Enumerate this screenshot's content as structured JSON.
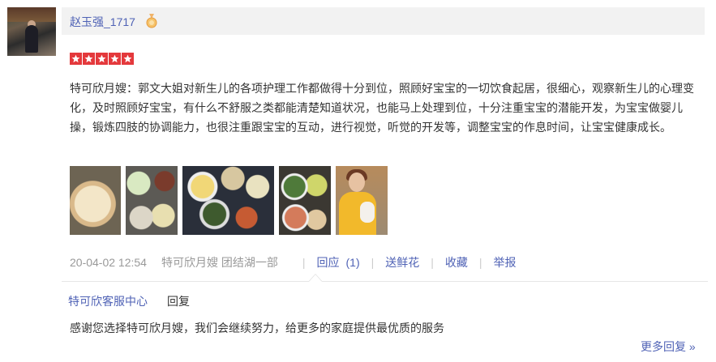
{
  "review": {
    "username": "赵玉强_1717",
    "badge_icon": "medal-icon",
    "rating": 5,
    "rating_color": "#e4393c",
    "text": "特可欣月嫂：郭文大姐对新生儿的各项护理工作都做得十分到位，照顾好宝宝的一切饮食起居，很细心，观察新生儿的心理变化，及时照顾好宝宝，有什么不舒服之类都能清楚知道状况，也能马上处理到位，十分注重宝宝的潜能开发，为宝宝做婴儿操，锻炼四肢的协调能力，也很注重跟宝宝的互动，进行视觉，听觉的开发等，调整宝宝的作息时间，让宝宝健康成长。",
    "photos": [
      "food-photo-1",
      "food-photo-2",
      "food-photo-3",
      "food-photo-4",
      "nanny-with-baby-photo"
    ]
  },
  "meta": {
    "date": "20-04-02 12:54",
    "author": "特可欣月嫂 团结湖一部",
    "reply_label": "回应",
    "reply_count": "(1)",
    "flower_label": "送鲜花",
    "favorite_label": "收藏",
    "report_label": "举报",
    "separator": "|"
  },
  "reply": {
    "replier": "特可欣客服中心",
    "tag": "回复",
    "text": "感谢您选择特可欣月嫂，我们会继续努力，给更多的家庭提供最优质的服务",
    "more_label": "更多回复 »"
  },
  "colors": {
    "link": "#4f62b5",
    "muted": "#999999",
    "text": "#333333"
  }
}
